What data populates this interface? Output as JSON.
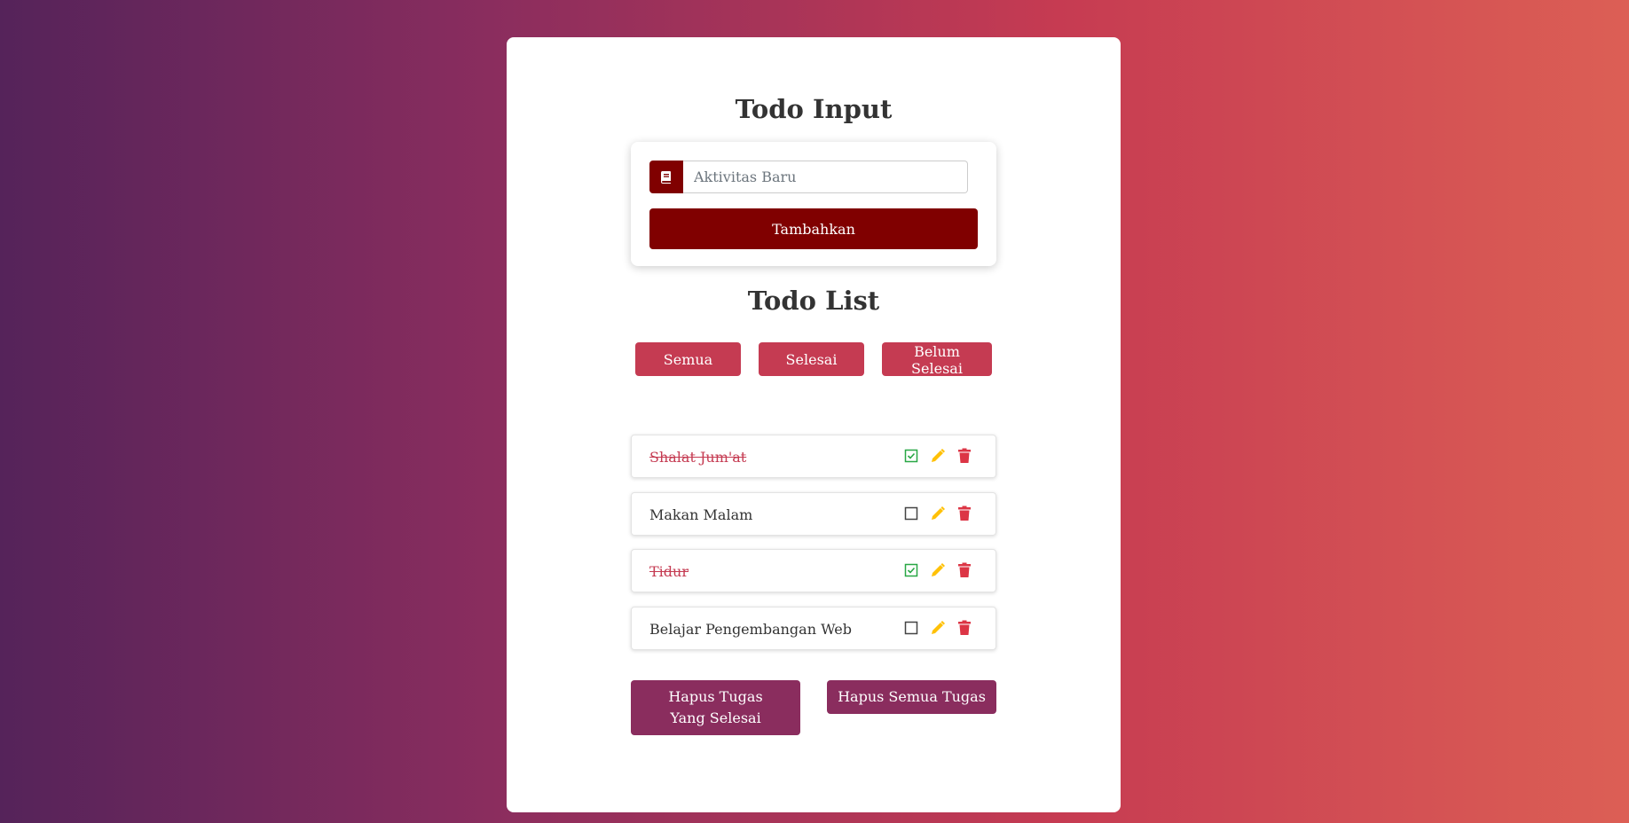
{
  "input_section": {
    "title": "Todo Input",
    "placeholder": "Aktivitas Baru",
    "icon": "book-icon",
    "add_label": "Tambahkan"
  },
  "list_section": {
    "title": "Todo List",
    "filters": [
      "Semua",
      "Selesai",
      "Belum Selesai"
    ]
  },
  "todos": [
    {
      "text": "Shalat Jum'at",
      "done": true
    },
    {
      "text": "Makan Malam",
      "done": false
    },
    {
      "text": "Tidur",
      "done": true
    },
    {
      "text": "Belajar Pengembangan Web",
      "done": false
    }
  ],
  "actions": {
    "delete_done_label": "Hapus Tugas Yang Selesai",
    "delete_all_label": "Hapus Semua Tugas"
  },
  "colors": {
    "primary": "#800000",
    "filter": "#c53b52",
    "action": "#8a2d5e",
    "check": "#28a745",
    "edit": "#ffc107",
    "delete": "#dc3545"
  }
}
